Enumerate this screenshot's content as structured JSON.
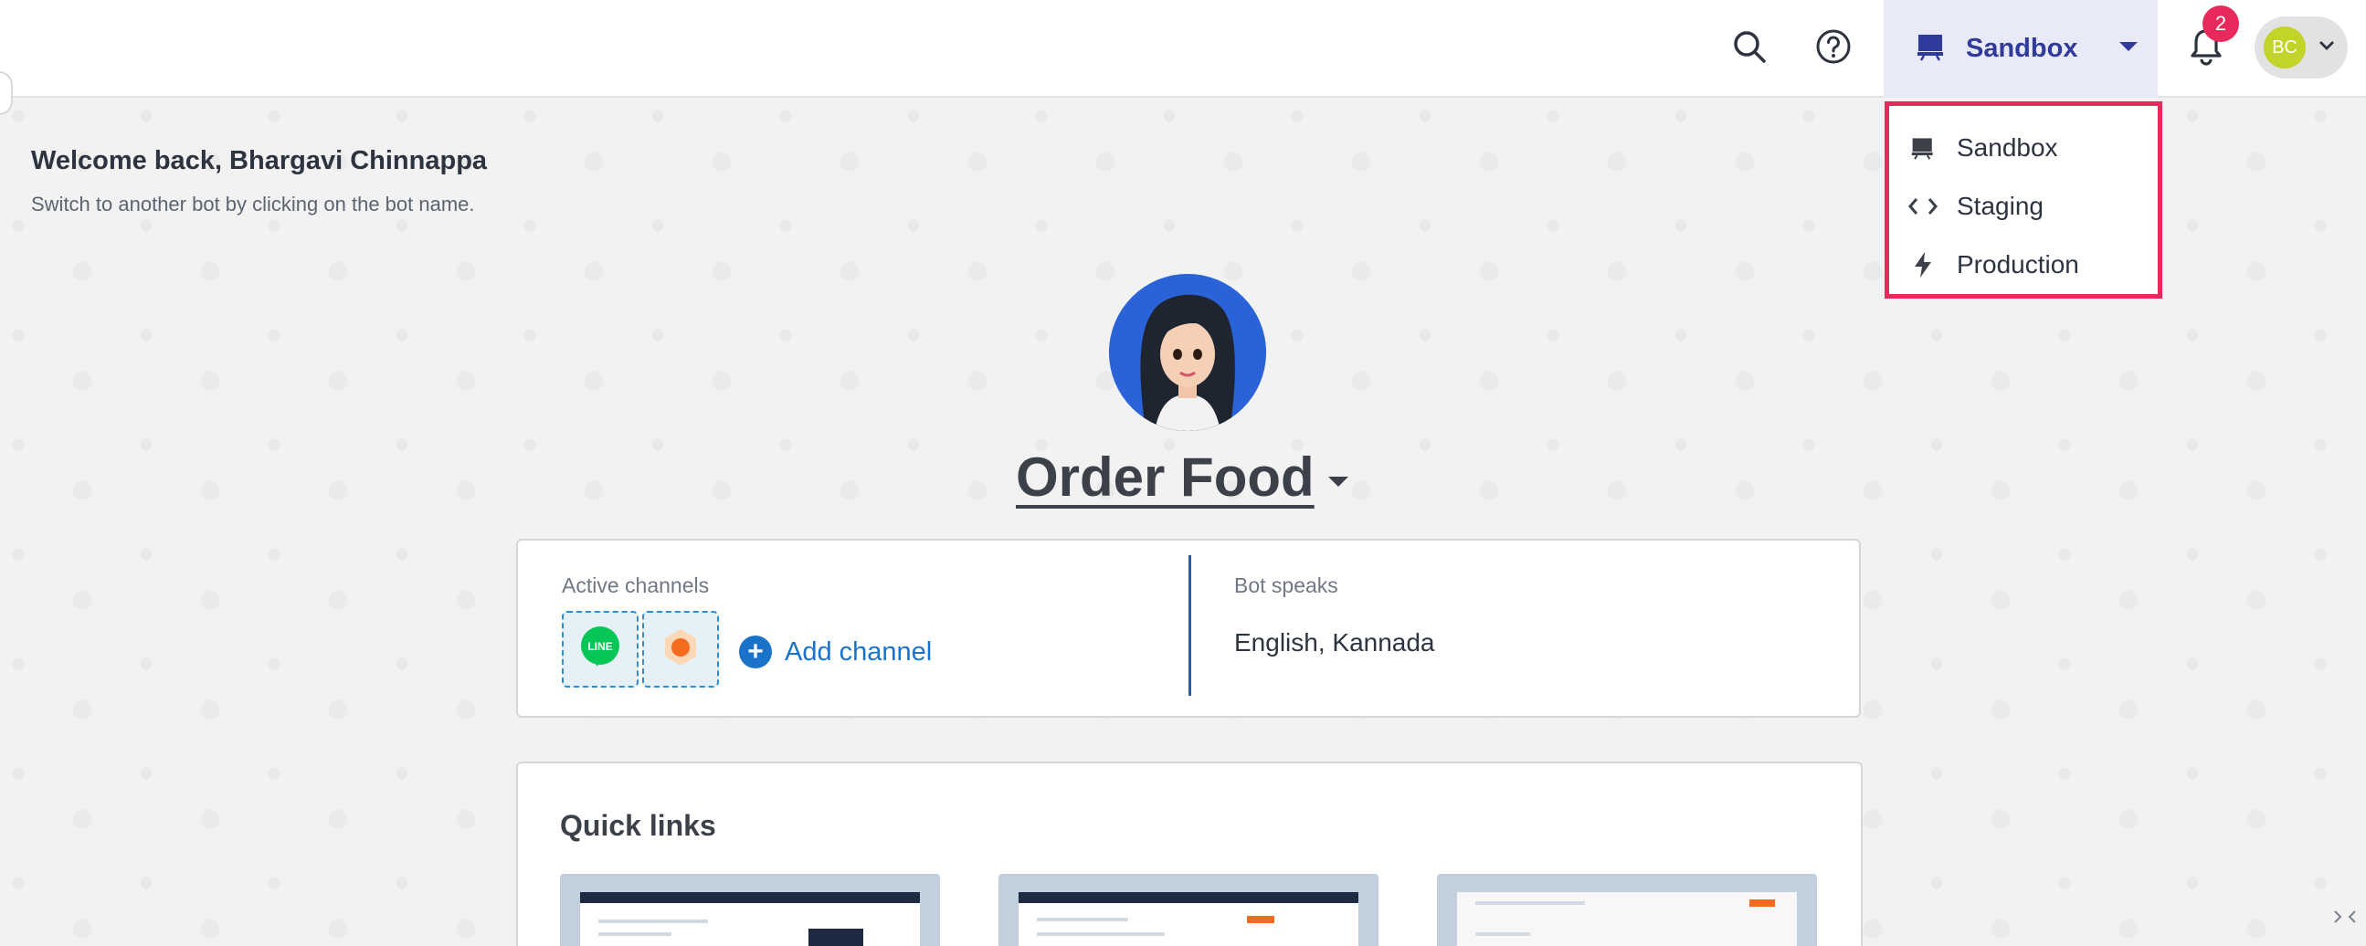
{
  "topbar": {
    "environment": {
      "label": "Sandbox"
    },
    "notifications": {
      "count": "2"
    },
    "user": {
      "initials": "BC"
    }
  },
  "env_dropdown": {
    "items": [
      {
        "label": "Sandbox",
        "icon": "monitor-icon"
      },
      {
        "label": "Staging",
        "icon": "code-icon"
      },
      {
        "label": "Production",
        "icon": "bolt-icon"
      }
    ]
  },
  "welcome": {
    "title": "Welcome back, Bhargavi Chinnappa",
    "subtitle": "Switch to another bot by clicking on the bot name."
  },
  "bot": {
    "name": "Order Food"
  },
  "channels": {
    "active_label": "Active channels",
    "add_label": "Add channel",
    "line_badge": "LINE",
    "bot_speaks_label": "Bot speaks",
    "languages": "English, Kannada"
  },
  "quick_links": {
    "title": "Quick links"
  },
  "colors": {
    "accent": "#2f3a9a",
    "highlight_border": "#e8295b",
    "link": "#1a73c9",
    "line_green": "#06c755",
    "orange": "#f46a1f"
  }
}
